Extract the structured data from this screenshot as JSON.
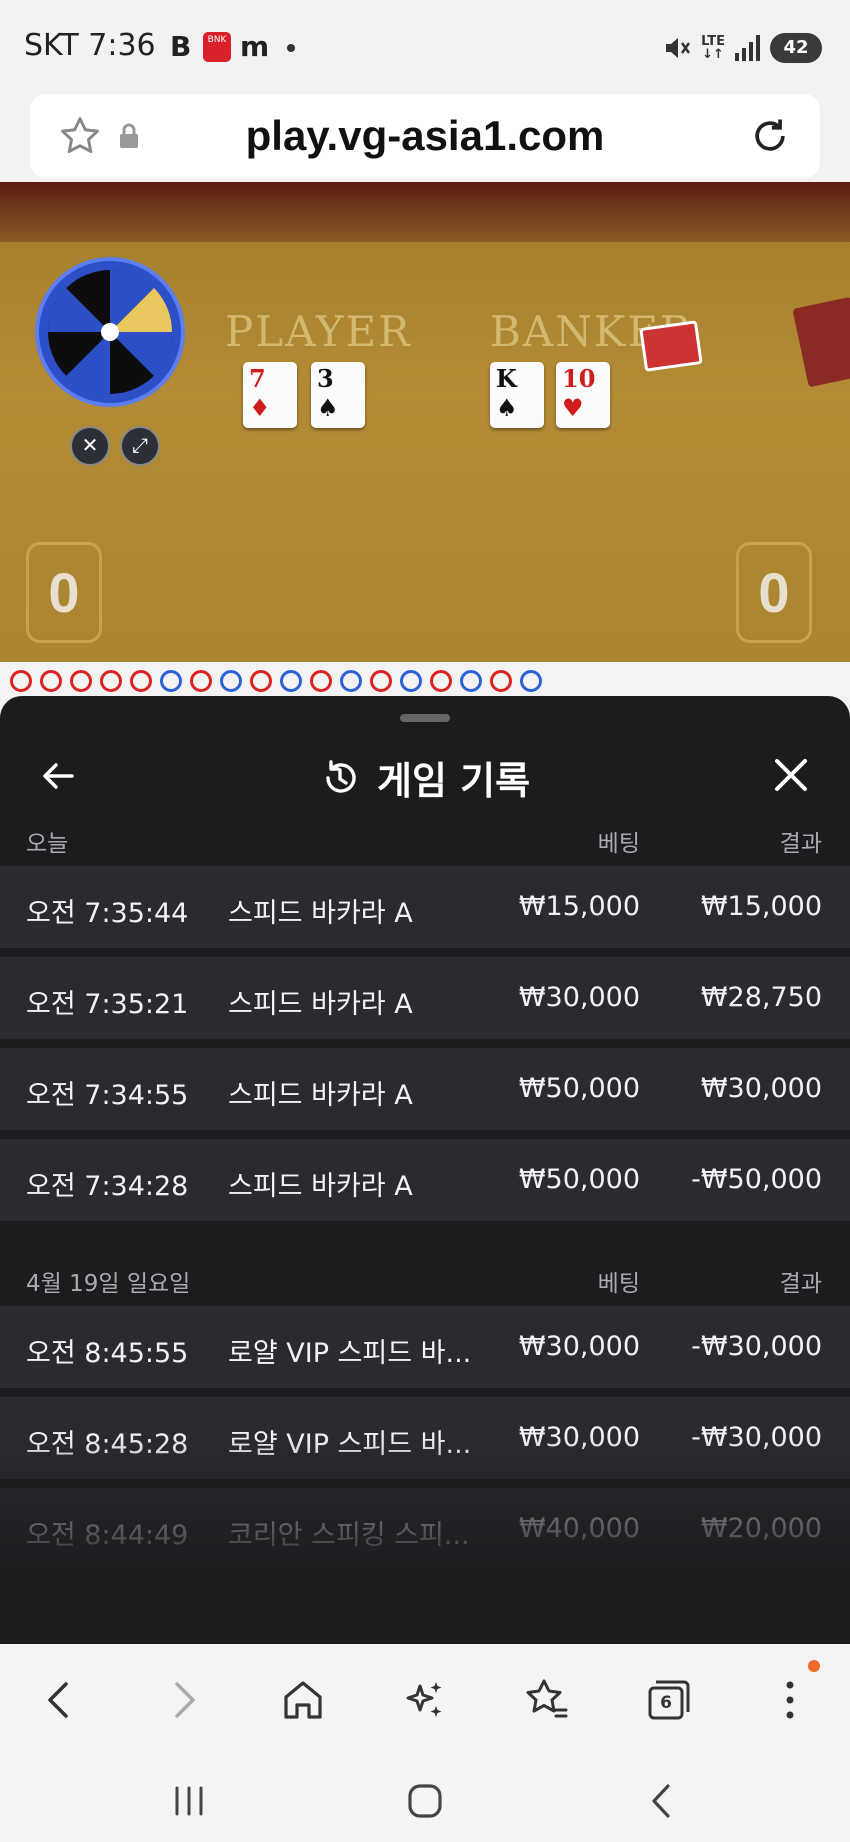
{
  "status": {
    "carrier": "SKT",
    "time": "7:36",
    "notif_b": "B",
    "notif_bnk": "BNK",
    "notif_m": "m",
    "network": "LTE",
    "battery": "42"
  },
  "browser": {
    "url": "play.vg-asia1.com"
  },
  "game_view": {
    "player_label": "PLAYER",
    "banker_label": "BANKER",
    "player_cards": [
      {
        "rank": "7",
        "suit": "♦",
        "color": "red"
      },
      {
        "rank": "3",
        "suit": "♠",
        "color": "black"
      }
    ],
    "banker_cards": [
      {
        "rank": "K",
        "suit": "♠",
        "color": "black"
      },
      {
        "rank": "10",
        "suit": "♥",
        "color": "red"
      }
    ],
    "player_score": "0",
    "banker_score": "0"
  },
  "sheet": {
    "title": "게임 기록",
    "sections": [
      {
        "date": "오늘",
        "bet_header": "베팅",
        "result_header": "결과",
        "rows": [
          {
            "time": "오전 7:35:44",
            "game": "스피드 바카라 A",
            "bet": "₩15,000",
            "result": "₩15,000"
          },
          {
            "time": "오전 7:35:21",
            "game": "스피드 바카라 A",
            "bet": "₩30,000",
            "result": "₩28,750"
          },
          {
            "time": "오전 7:34:55",
            "game": "스피드 바카라 A",
            "bet": "₩50,000",
            "result": "₩30,000"
          },
          {
            "time": "오전 7:34:28",
            "game": "스피드 바카라 A",
            "bet": "₩50,000",
            "result": "-₩50,000"
          }
        ]
      },
      {
        "date": "4월 19일 일요일",
        "bet_header": "베팅",
        "result_header": "결과",
        "rows": [
          {
            "time": "오전 8:45:55",
            "game": "로얄 VIP 스피드 바...",
            "bet": "₩30,000",
            "result": "-₩30,000"
          },
          {
            "time": "오전 8:45:28",
            "game": "로얄 VIP 스피드 바...",
            "bet": "₩30,000",
            "result": "-₩30,000"
          },
          {
            "time": "오전 8:44:49",
            "game": "코리안 스피킹 스피...",
            "bet": "₩40,000",
            "result": "₩20,000"
          }
        ]
      }
    ]
  },
  "browser_nav": {
    "tabs_count": "6"
  },
  "colors": {
    "sheet_bg": "#1c1c1f",
    "row_bg": "#2b2b2f",
    "header_text": "#a9a9b0",
    "notification_dot": "#ef6b2a"
  },
  "icons": [
    "star-icon",
    "lock-icon",
    "reload-icon",
    "back-arrow-icon",
    "history-icon",
    "close-icon",
    "nav-back-icon",
    "nav-forward-icon",
    "home-icon",
    "ai-sparkle-icon",
    "bookmarks-icon",
    "tabs-icon",
    "menu-icon"
  ]
}
